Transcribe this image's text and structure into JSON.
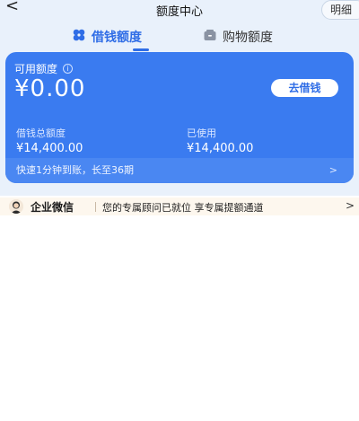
{
  "nav": {
    "back_glyph": "<",
    "title": "额度中心",
    "detail_label": "明细"
  },
  "tabs": [
    {
      "label": "借钱额度",
      "icon": "clover-icon",
      "active": true
    },
    {
      "label": "购物额度",
      "icon": "wallet-icon",
      "active": false
    }
  ],
  "card": {
    "available_label": "可用额度",
    "available_amount": "¥0.00",
    "borrow_button": "去借钱",
    "total_label": "借钱总额度",
    "total_value": "¥14,400.00",
    "used_label": "已使用",
    "used_value": "¥14,400.00",
    "footer_text": "快速1分钟到账，长至36期",
    "footer_chevron": ">"
  },
  "wechat": {
    "title": "企业微信",
    "message": "您的专属顾问已就位 享专属提额通道",
    "chevron": ">"
  },
  "colors": {
    "accent": "#2f6de6",
    "card_bg": "#3a7bf0",
    "top_bg": "#e9f1fb",
    "banner_bg": "#fdf7ee"
  }
}
